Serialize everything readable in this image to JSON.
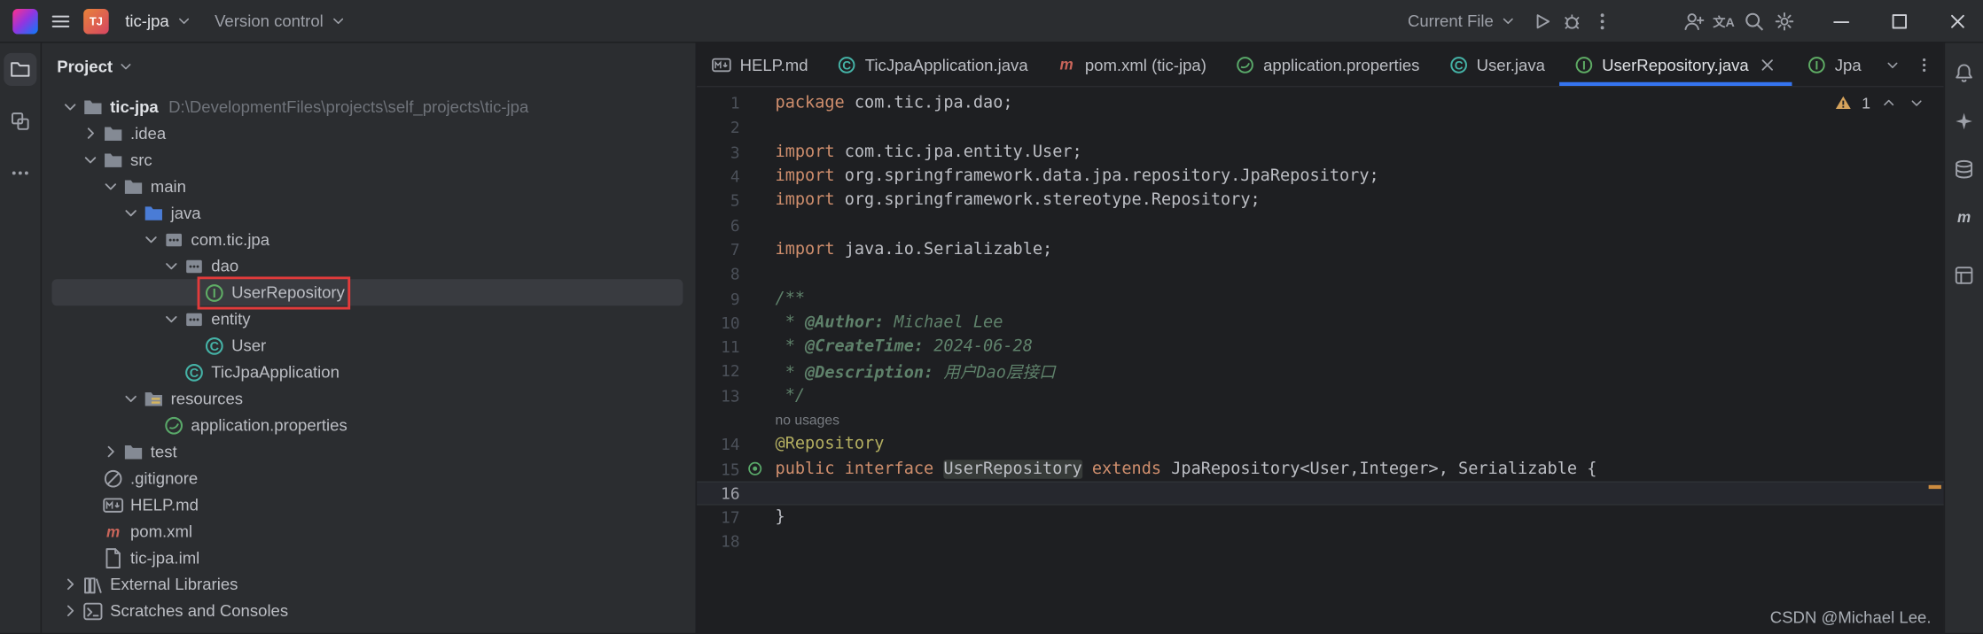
{
  "title_bar": {
    "project_badge": "TJ",
    "project_name": "tic-jpa",
    "vcs_button": "Version control",
    "run_config": "Current File"
  },
  "activity_bar": {
    "items": [
      {
        "icon": "project-folder",
        "active": true
      },
      {
        "icon": "structure",
        "active": false
      },
      {
        "icon": "more-horizontal",
        "active": false
      }
    ]
  },
  "project_panel": {
    "header": "Project",
    "tree": [
      {
        "label": "tic-jpa",
        "path": "D:\\DevelopmentFiles\\projects\\self_projects\\tic-jpa",
        "depth": 0,
        "icon": "folder",
        "chevron": "expanded",
        "bold": true
      },
      {
        "label": ".idea",
        "depth": 1,
        "icon": "folder",
        "chevron": "collapsed"
      },
      {
        "label": "src",
        "depth": 1,
        "icon": "folder",
        "chevron": "expanded"
      },
      {
        "label": "main",
        "depth": 2,
        "icon": "folder",
        "chevron": "expanded"
      },
      {
        "label": "java",
        "depth": 3,
        "icon": "folder-source",
        "chevron": "expanded"
      },
      {
        "label": "com.tic.jpa",
        "depth": 4,
        "icon": "package",
        "chevron": "expanded"
      },
      {
        "label": "dao",
        "depth": 5,
        "icon": "package",
        "chevron": "expanded"
      },
      {
        "label": "UserRepository",
        "depth": 6,
        "icon": "interface",
        "chevron": "none",
        "selected": true,
        "annotated": true
      },
      {
        "label": "entity",
        "depth": 5,
        "icon": "package",
        "chevron": "expanded"
      },
      {
        "label": "User",
        "depth": 6,
        "icon": "class",
        "chevron": "none"
      },
      {
        "label": "TicJpaApplication",
        "depth": 5,
        "icon": "class",
        "chevron": "none"
      },
      {
        "label": "resources",
        "depth": 3,
        "icon": "folder-resources",
        "chevron": "expanded"
      },
      {
        "label": "application.properties",
        "depth": 4,
        "icon": "spring",
        "chevron": "none"
      },
      {
        "label": "test",
        "depth": 2,
        "icon": "folder",
        "chevron": "collapsed"
      },
      {
        "label": ".gitignore",
        "depth": 1,
        "icon": "gitignore",
        "chevron": "none"
      },
      {
        "label": "HELP.md",
        "depth": 1,
        "icon": "markdown",
        "chevron": "none"
      },
      {
        "label": "pom.xml",
        "depth": 1,
        "icon": "maven",
        "chevron": "none"
      },
      {
        "label": "tic-jpa.iml",
        "depth": 1,
        "icon": "file",
        "chevron": "none"
      },
      {
        "label": "External Libraries",
        "depth": 0,
        "icon": "library",
        "chevron": "collapsed"
      },
      {
        "label": "Scratches and Consoles",
        "depth": 0,
        "icon": "scratches",
        "chevron": "collapsed"
      }
    ]
  },
  "editor": {
    "tabs": [
      {
        "icon": "markdown",
        "label": "HELP.md"
      },
      {
        "icon": "class",
        "label": "TicJpaApplication.java"
      },
      {
        "icon": "maven",
        "label": "pom.xml (tic-jpa)"
      },
      {
        "icon": "spring",
        "label": "application.properties"
      },
      {
        "icon": "class",
        "label": "User.java"
      },
      {
        "icon": "interface",
        "label": "UserRepository.java",
        "active": true,
        "closable": true
      },
      {
        "icon": "interface",
        "label": "Jpa",
        "truncated": true
      }
    ],
    "inspection": {
      "warning_count": "1"
    },
    "code": [
      {
        "n": "1",
        "t": [
          [
            "kw",
            "package"
          ],
          [
            "pl",
            " com.tic.jpa.dao;"
          ]
        ]
      },
      {
        "n": "2",
        "t": []
      },
      {
        "n": "3",
        "t": [
          [
            "kw",
            "import"
          ],
          [
            "pl",
            " com.tic.jpa.entity.User;"
          ]
        ]
      },
      {
        "n": "4",
        "t": [
          [
            "kw",
            "import"
          ],
          [
            "pl",
            " org.springframework.data.jpa.repository.JpaRepository;"
          ]
        ]
      },
      {
        "n": "5",
        "t": [
          [
            "kw",
            "import"
          ],
          [
            "pl",
            " org.springframework.stereotype.Repository;"
          ]
        ]
      },
      {
        "n": "6",
        "t": []
      },
      {
        "n": "7",
        "t": [
          [
            "kw",
            "import"
          ],
          [
            "pl",
            " java.io.Serializable;"
          ]
        ]
      },
      {
        "n": "8",
        "t": []
      },
      {
        "n": "9",
        "t": [
          [
            "cm",
            "/**"
          ]
        ]
      },
      {
        "n": "10",
        "t": [
          [
            "cm",
            " * "
          ],
          [
            "tag",
            "@Author: "
          ],
          [
            "cm",
            "Michael Lee"
          ]
        ]
      },
      {
        "n": "11",
        "t": [
          [
            "cm",
            " * "
          ],
          [
            "tag",
            "@CreateTime: "
          ],
          [
            "cm",
            "2024-06-28"
          ]
        ]
      },
      {
        "n": "12",
        "t": [
          [
            "cm",
            " * "
          ],
          [
            "tag",
            "@Description: "
          ],
          [
            "cm",
            "用户Dao层接口"
          ]
        ]
      },
      {
        "n": "13",
        "t": [
          [
            "cm",
            " */"
          ]
        ]
      },
      {
        "n": "",
        "hint": true,
        "t": [
          [
            "hint",
            "no usages"
          ]
        ]
      },
      {
        "n": "14",
        "t": [
          [
            "ann",
            "@Repository"
          ]
        ]
      },
      {
        "n": "15",
        "gutter": "spring-bean",
        "marker": true,
        "t": [
          [
            "kw",
            "public"
          ],
          [
            "pl",
            " "
          ],
          [
            "kw",
            "interface"
          ],
          [
            "pl",
            " "
          ],
          [
            "hl",
            "UserRepository"
          ],
          [
            "pl",
            " "
          ],
          [
            "kw",
            "extends"
          ],
          [
            "pl",
            " JpaRepository<User,Integer>, Serializable {"
          ]
        ]
      },
      {
        "n": "16",
        "caret": true,
        "t": []
      },
      {
        "n": "17",
        "t": [
          [
            "pl",
            "}"
          ]
        ]
      },
      {
        "n": "18",
        "t": []
      }
    ],
    "watermark": "CSDN @Michael Lee."
  },
  "right_bar": {
    "items": [
      {
        "icon": "bell"
      },
      {
        "icon": "ai-star"
      },
      {
        "icon": "database"
      },
      {
        "icon": "maven-m"
      },
      {
        "icon": "tool-frame"
      }
    ]
  },
  "icons": {
    "project_badge_text": "TJ",
    "maven_glyph": "m",
    "translate_glyph": "文A",
    "interface_glyph": "I",
    "class_glyph": "C"
  },
  "colors": {
    "accent": "#3574F0",
    "selection": "#393B40",
    "annotation_red": "#E23B3B",
    "warning": "#D6A35C",
    "editor_bg": "#1E1F22",
    "panel_bg": "#2B2D30"
  }
}
